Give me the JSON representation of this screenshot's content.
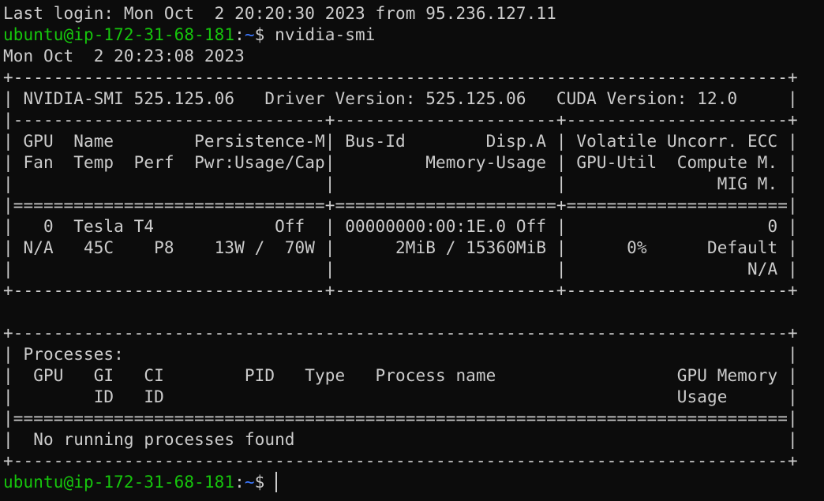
{
  "colors": {
    "background": "#0c0c0c",
    "foreground": "#cccccc",
    "prompt_user": "#16c60c",
    "prompt_path": "#3b78ff"
  },
  "session": {
    "last_login": "Last login: Mon Oct  2 20:20:30 2023 from 95.236.127.11",
    "prompt_user_host": "ubuntu@ip-172-31-68-181",
    "prompt_sep": ":",
    "prompt_path": "~",
    "prompt_symbol": "$ ",
    "command": "nvidia-smi",
    "date_line": "Mon Oct  2 20:23:08 2023"
  },
  "output_lines": [
    "+-----------------------------------------------------------------------------+",
    "| NVIDIA-SMI 525.125.06   Driver Version: 525.125.06   CUDA Version: 12.0     |",
    "|-------------------------------+----------------------+----------------------+",
    "| GPU  Name        Persistence-M| Bus-Id        Disp.A | Volatile Uncorr. ECC |",
    "| Fan  Temp  Perf  Pwr:Usage/Cap|         Memory-Usage | GPU-Util  Compute M. |",
    "|                               |                      |               MIG M. |",
    "|===============================+======================+======================|",
    "|   0  Tesla T4            Off  | 00000000:00:1E.0 Off |                    0 |",
    "| N/A   45C    P8    13W /  70W |      2MiB / 15360MiB |      0%      Default |",
    "|                               |                      |                  N/A |",
    "+-------------------------------+----------------------+----------------------+",
    "",
    "+-----------------------------------------------------------------------------+",
    "| Processes:                                                                  |",
    "|  GPU   GI   CI        PID   Type   Process name                  GPU Memory |",
    "|        ID   ID                                                   Usage      |",
    "|=============================================================================|",
    "|  No running processes found                                                 |",
    "+-----------------------------------------------------------------------------+"
  ]
}
